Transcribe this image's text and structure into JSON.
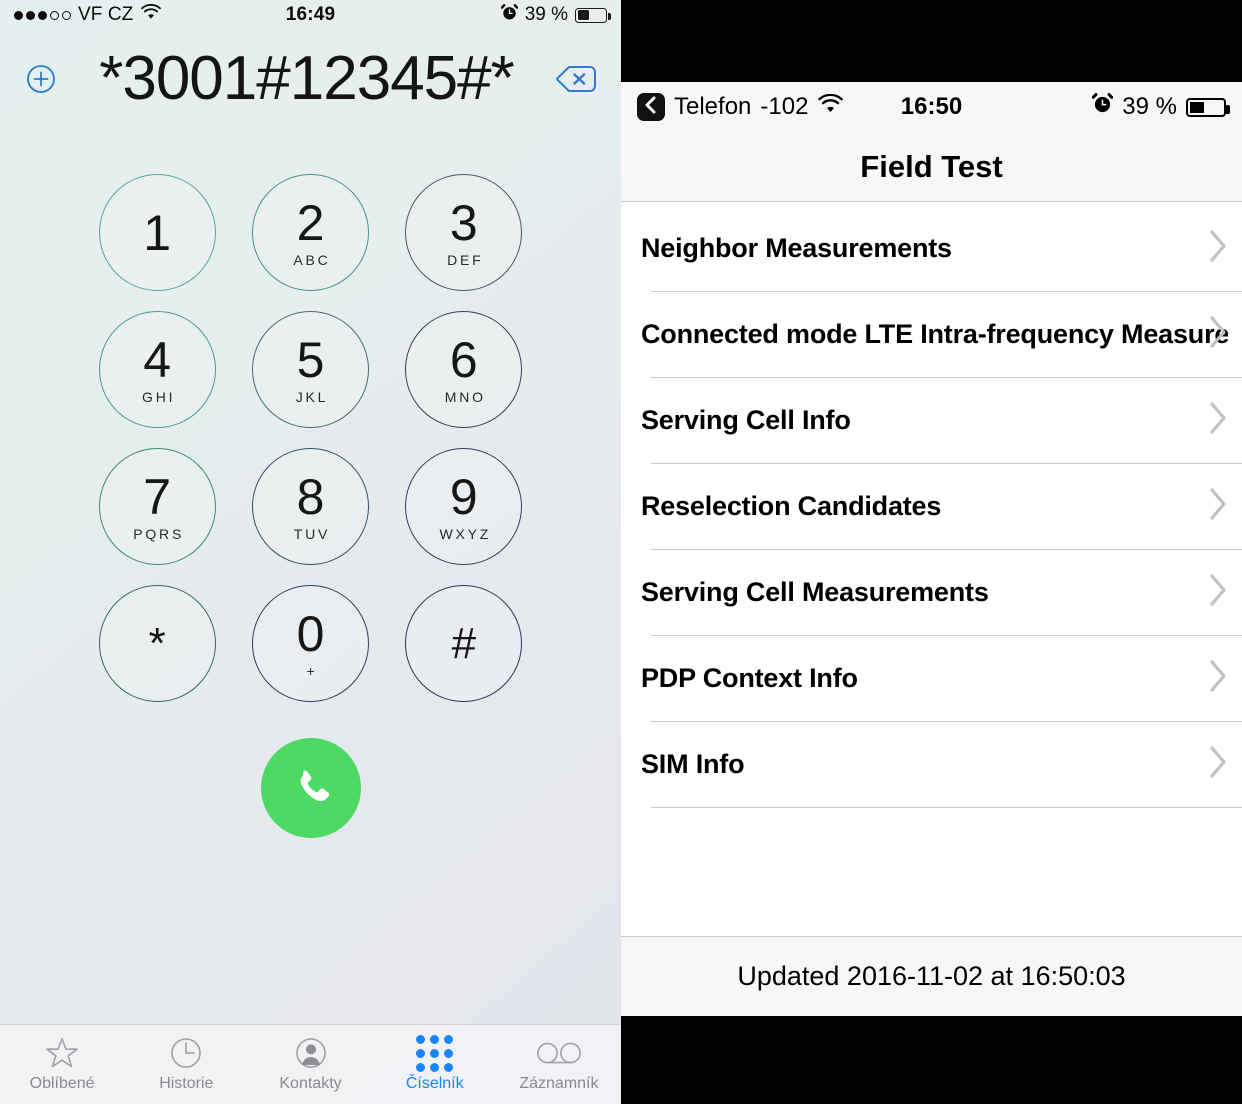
{
  "dialer": {
    "status_bar": {
      "signal_dots_filled": 3,
      "signal_dots_total": 5,
      "carrier": "VF CZ",
      "wifi_icon": "wifi-icon",
      "time": "16:49",
      "alarm_icon": "alarm-icon",
      "battery_percent": "39 %",
      "battery_level": 39
    },
    "display": {
      "add_contact_icon": "plus-circle-icon",
      "number": "*3001#12345#*",
      "delete_icon": "backspace-icon"
    },
    "keys": [
      {
        "num": "1",
        "sub": ""
      },
      {
        "num": "2",
        "sub": "ABC"
      },
      {
        "num": "3",
        "sub": "DEF"
      },
      {
        "num": "4",
        "sub": "GHI"
      },
      {
        "num": "5",
        "sub": "JKL"
      },
      {
        "num": "6",
        "sub": "MNO"
      },
      {
        "num": "7",
        "sub": "PQRS"
      },
      {
        "num": "8",
        "sub": "TUV"
      },
      {
        "num": "9",
        "sub": "WXYZ"
      },
      {
        "num": "*",
        "sub": ""
      },
      {
        "num": "0",
        "sub": "+"
      },
      {
        "num": "#",
        "sub": ""
      }
    ],
    "call_button": {
      "icon": "phone-handset-icon",
      "color": "#4cd964"
    },
    "tabs": [
      {
        "label": "Oblíbené",
        "icon": "star-icon",
        "active": false
      },
      {
        "label": "Historie",
        "icon": "clock-icon",
        "active": false
      },
      {
        "label": "Kontakty",
        "icon": "person-icon",
        "active": false
      },
      {
        "label": "Číselník",
        "icon": "keypad-icon",
        "active": true
      },
      {
        "label": "Záznamník",
        "icon": "voicemail-icon",
        "active": false
      }
    ],
    "accent_color": "#1b84ff"
  },
  "field_test": {
    "status_bar": {
      "back_icon": "chevron-left-icon",
      "back_label": "Telefon",
      "signal_dbm": "-102",
      "wifi_icon": "wifi-icon",
      "time": "16:50",
      "alarm_icon": "alarm-icon",
      "battery_percent": "39 %",
      "battery_level": 39
    },
    "title": "Field Test",
    "rows": [
      {
        "label": "Neighbor Measurements",
        "chevron": "chevron-right-icon"
      },
      {
        "label": "Connected mode LTE Intra-frequency Measurements",
        "chevron": "chevron-right-icon"
      },
      {
        "label": "Serving Cell Info",
        "chevron": "chevron-right-icon"
      },
      {
        "label": "Reselection Candidates",
        "chevron": "chevron-right-icon"
      },
      {
        "label": "Serving Cell Measurements",
        "chevron": "chevron-right-icon"
      },
      {
        "label": "PDP Context Info",
        "chevron": "chevron-right-icon"
      },
      {
        "label": "SIM Info",
        "chevron": "chevron-right-icon"
      }
    ],
    "footer": "Updated 2016-11-02 at 16:50:03"
  }
}
